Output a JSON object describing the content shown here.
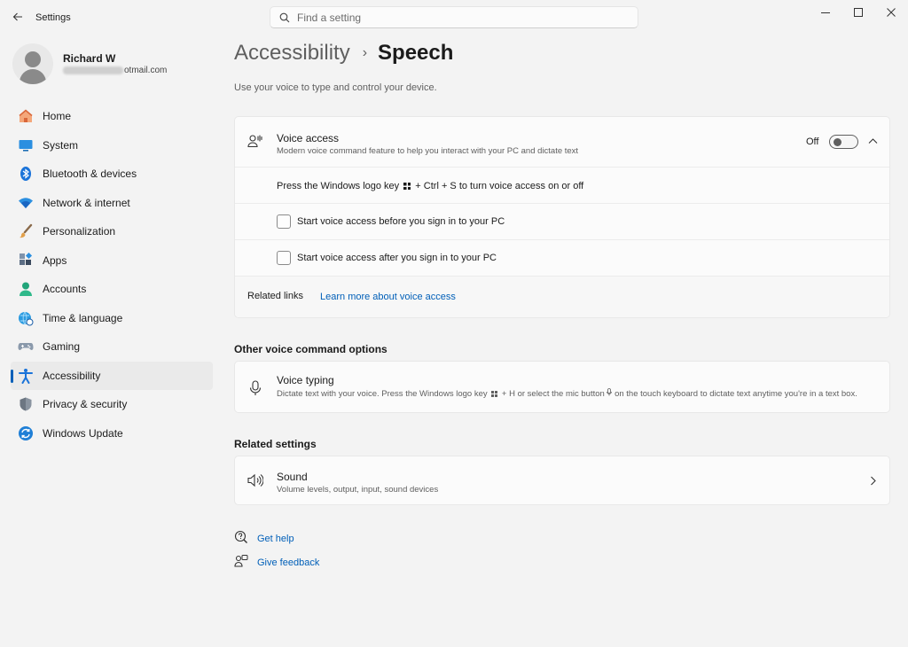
{
  "window": {
    "title": "Settings",
    "search_placeholder": "Find a setting"
  },
  "user": {
    "name": "Richard W",
    "email_visible": "otmail.com"
  },
  "sidebar": {
    "items": [
      {
        "label": "Home",
        "icon": "home-icon"
      },
      {
        "label": "System",
        "icon": "system-icon"
      },
      {
        "label": "Bluetooth & devices",
        "icon": "bluetooth-icon"
      },
      {
        "label": "Network & internet",
        "icon": "wifi-icon"
      },
      {
        "label": "Personalization",
        "icon": "brush-icon"
      },
      {
        "label": "Apps",
        "icon": "apps-icon"
      },
      {
        "label": "Accounts",
        "icon": "accounts-icon"
      },
      {
        "label": "Time & language",
        "icon": "globe-icon"
      },
      {
        "label": "Gaming",
        "icon": "gamepad-icon"
      },
      {
        "label": "Accessibility",
        "icon": "accessibility-icon",
        "active": true
      },
      {
        "label": "Privacy & security",
        "icon": "shield-icon"
      },
      {
        "label": "Windows Update",
        "icon": "update-icon"
      }
    ]
  },
  "main": {
    "breadcrumb_parent": "Accessibility",
    "breadcrumb_current": "Speech",
    "subtitle": "Use your voice to type and control your device.",
    "voice_access": {
      "title": "Voice access",
      "description": "Modern voice command feature to help you interact with your PC and dictate text",
      "toggle_state": "Off",
      "shortcut_before": "Press the Windows logo key",
      "shortcut_after": "+ Ctrl + S to turn voice access on or off",
      "option_before_signin": "Start voice access before you sign in to your PC",
      "option_after_signin": "Start voice access after you sign in to your PC",
      "related_links_label": "Related links",
      "learn_more_link": "Learn more about voice access"
    },
    "other_options": {
      "heading": "Other voice command options",
      "voice_typing_title": "Voice typing",
      "voice_typing_desc_1": "Dictate text with your voice. Press the Windows logo key",
      "voice_typing_desc_2": "+ H or select the mic button",
      "voice_typing_desc_3": "on the touch keyboard to dictate text anytime you're in a text box."
    },
    "related_settings": {
      "heading": "Related settings",
      "sound_title": "Sound",
      "sound_desc": "Volume levels, output, input, sound devices"
    },
    "help": {
      "get_help": "Get help",
      "give_feedback": "Give feedback"
    }
  },
  "colors": {
    "accent": "#005fb8",
    "background": "#f3f3f3",
    "card": "#fbfbfb"
  }
}
